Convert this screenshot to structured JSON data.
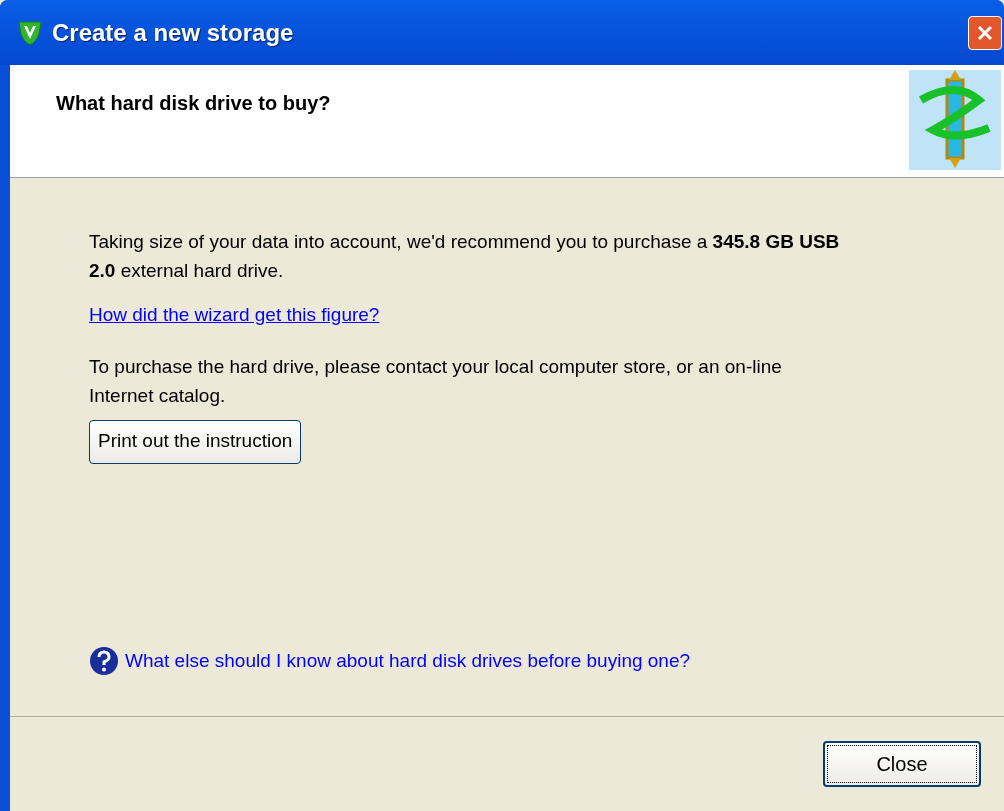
{
  "window": {
    "title": "Create a new storage"
  },
  "header": {
    "title": "What hard disk drive to buy?"
  },
  "body": {
    "recommendation": "Taking size of your data into account, we'd recommend you to purchase a **345.8 GB USB 2.0** external hard drive.",
    "figure_link": "How did the wizard get this figure?",
    "purchase_note": "To purchase the hard drive, please contact your local computer store, or an on-line Internet catalog.",
    "print_button": "Print out the instruction",
    "help_link": "What else should I know about hard disk drives before buying one?"
  },
  "buttons": [
    "Close"
  ]
}
